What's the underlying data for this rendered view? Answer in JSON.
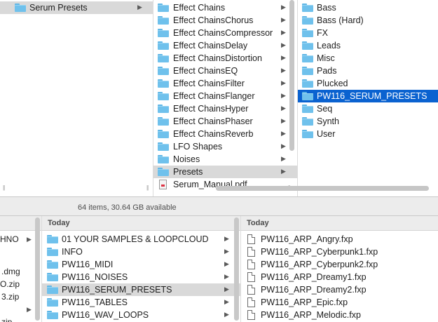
{
  "top_window": {
    "col1": {
      "items": [
        {
          "label": "Serum Presets",
          "icon": "folder-icon",
          "selected": true,
          "has_children": true
        }
      ]
    },
    "col2": {
      "items": [
        {
          "label": "Effect Chains",
          "icon": "folder-icon",
          "has_children": true
        },
        {
          "label": "Effect ChainsChorus",
          "icon": "folder-icon",
          "has_children": true
        },
        {
          "label": "Effect ChainsCompressor",
          "icon": "folder-icon",
          "has_children": true
        },
        {
          "label": "Effect ChainsDelay",
          "icon": "folder-icon",
          "has_children": true
        },
        {
          "label": "Effect ChainsDistortion",
          "icon": "folder-icon",
          "has_children": true
        },
        {
          "label": "Effect ChainsEQ",
          "icon": "folder-icon",
          "has_children": true
        },
        {
          "label": "Effect ChainsFilter",
          "icon": "folder-icon",
          "has_children": true
        },
        {
          "label": "Effect ChainsFlanger",
          "icon": "folder-icon",
          "has_children": true
        },
        {
          "label": "Effect ChainsHyper",
          "icon": "folder-icon",
          "has_children": true
        },
        {
          "label": "Effect ChainsPhaser",
          "icon": "folder-icon",
          "has_children": true
        },
        {
          "label": "Effect ChainsReverb",
          "icon": "folder-icon",
          "has_children": true
        },
        {
          "label": "LFO Shapes",
          "icon": "folder-icon",
          "has_children": true
        },
        {
          "label": "Noises",
          "icon": "folder-icon",
          "has_children": true
        },
        {
          "label": "Presets",
          "icon": "folder-icon",
          "has_children": true,
          "selected": true
        },
        {
          "label": "Serum_Manual.pdf",
          "icon": "pdf-icon",
          "has_children": false
        }
      ]
    },
    "col3": {
      "items": [
        {
          "label": "Bass",
          "icon": "folder-icon"
        },
        {
          "label": "Bass (Hard)",
          "icon": "folder-icon"
        },
        {
          "label": "FX",
          "icon": "folder-icon"
        },
        {
          "label": "Leads",
          "icon": "folder-icon"
        },
        {
          "label": "Misc",
          "icon": "folder-icon"
        },
        {
          "label": "Pads",
          "icon": "folder-icon"
        },
        {
          "label": "Plucked",
          "icon": "folder-icon"
        },
        {
          "label": "PW116_SERUM_PRESETS",
          "icon": "folder-icon",
          "selected": true
        },
        {
          "label": "Seq",
          "icon": "folder-icon"
        },
        {
          "label": "Synth",
          "icon": "folder-icon"
        },
        {
          "label": "User",
          "icon": "folder-icon"
        }
      ]
    }
  },
  "status": {
    "text": "64 items, 30.64 GB available"
  },
  "bottom_window": {
    "col1": {
      "partial_items": [
        "HNO",
        ".dmg",
        "O.zip",
        "3.zip",
        "zip"
      ]
    },
    "col2": {
      "header": "Today",
      "items": [
        {
          "label": "01 YOUR SAMPLES & LOOPCLOUD",
          "icon": "folder-icon"
        },
        {
          "label": "INFO",
          "icon": "folder-icon"
        },
        {
          "label": "PW116_MIDI",
          "icon": "folder-icon"
        },
        {
          "label": "PW116_NOISES",
          "icon": "folder-icon"
        },
        {
          "label": "PW116_SERUM_PRESETS",
          "icon": "folder-icon",
          "selected": true
        },
        {
          "label": "PW116_TABLES",
          "icon": "folder-icon"
        },
        {
          "label": "PW116_WAV_LOOPS",
          "icon": "folder-icon"
        }
      ]
    },
    "col3": {
      "header": "Today",
      "items": [
        {
          "label": "PW116_ARP_Angry.fxp",
          "icon": "document-icon"
        },
        {
          "label": "PW116_ARP_Cyberpunk1.fxp",
          "icon": "document-icon"
        },
        {
          "label": "PW116_ARP_Cyberpunk2.fxp",
          "icon": "document-icon"
        },
        {
          "label": "PW116_ARP_Dreamy1.fxp",
          "icon": "document-icon"
        },
        {
          "label": "PW116_ARP_Dreamy2.fxp",
          "icon": "document-icon"
        },
        {
          "label": "PW116_ARP_Epic.fxp",
          "icon": "document-icon"
        },
        {
          "label": "PW116_ARP_Melodic.fxp",
          "icon": "document-icon"
        }
      ]
    }
  },
  "glyphs": {
    "chevron": "▶",
    "resize": "||"
  },
  "colors": {
    "selection_blue": "#0a62d0",
    "selection_gray": "#d9d9d9",
    "folder": "#6fc1ec"
  }
}
